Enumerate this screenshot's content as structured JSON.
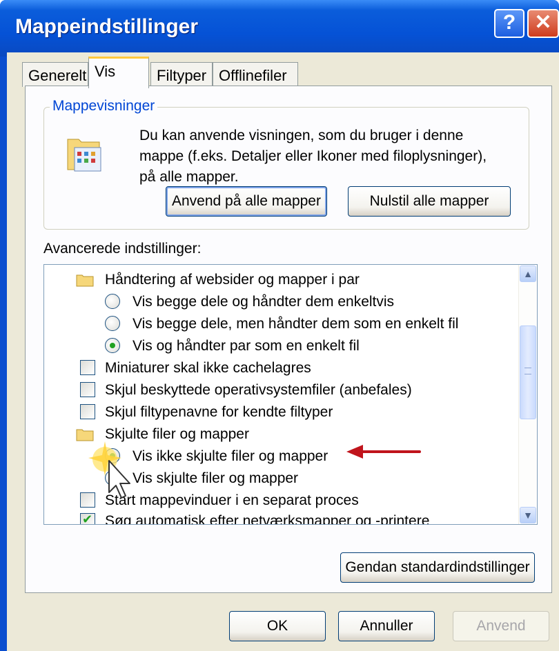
{
  "window": {
    "title": "Mappeindstillinger",
    "help_glyph": "?",
    "close_glyph": "✕"
  },
  "tabs": [
    {
      "label": "Generelt"
    },
    {
      "label": "Vis"
    },
    {
      "label": "Filtyper"
    },
    {
      "label": "Offlinefiler"
    }
  ],
  "folder_views": {
    "group_label": "Mappevisninger",
    "description": "Du kan anvende visningen, som du bruger i denne mappe (f.eks. Detaljer eller Ikoner med filoplysninger), på alle mapper.",
    "apply_all_label": "Anvend på alle mapper",
    "reset_all_label": "Nulstil alle mapper"
  },
  "advanced": {
    "label": "Avancerede indstillinger:",
    "items": [
      {
        "type": "folder",
        "text": "Håndtering af websider og mapper i par"
      },
      {
        "type": "radio",
        "text": "Vis begge dele og håndter dem enkeltvis",
        "checked": false
      },
      {
        "type": "radio",
        "text": "Vis begge dele, men håndter dem som en enkelt fil",
        "checked": false
      },
      {
        "type": "radio",
        "text": "Vis og håndter par som en enkelt fil",
        "checked": true
      },
      {
        "type": "checkbox",
        "text": "Miniaturer skal ikke cachelagres",
        "checked": false
      },
      {
        "type": "checkbox",
        "text": "Skjul beskyttede operativsystemfiler (anbefales)",
        "checked": false
      },
      {
        "type": "checkbox",
        "text": "Skjul filtypenavne for kendte filtyper",
        "checked": false
      },
      {
        "type": "folder",
        "text": "Skjulte filer og mapper"
      },
      {
        "type": "radio",
        "text": "Vis ikke skjulte filer og mapper",
        "checked": true
      },
      {
        "type": "radio",
        "text": "Vis skjulte filer og mapper",
        "checked": false
      },
      {
        "type": "checkbox",
        "text": "Start mappevinduer i en separat proces",
        "checked": false
      },
      {
        "type": "checkbox",
        "text": "Søg automatisk efter netværksmapper og -printere",
        "checked": true
      }
    ]
  },
  "restore_defaults_label": "Gendan standardindstillinger",
  "footer": {
    "ok_label": "OK",
    "cancel_label": "Annuller",
    "apply_label": "Anvend"
  },
  "colors": {
    "title_blue": "#0552d6",
    "client_bg": "#ece9d8",
    "tab_highlight": "#ffc83c",
    "annotation_arrow": "#c0141c",
    "check_green": "#21a121"
  },
  "icons": [
    "help-icon",
    "close-icon",
    "folder-view-icon",
    "folder-icon",
    "scroll-up-icon",
    "scroll-down-icon",
    "mouse-cursor-icon",
    "annotation-arrow-icon"
  ]
}
